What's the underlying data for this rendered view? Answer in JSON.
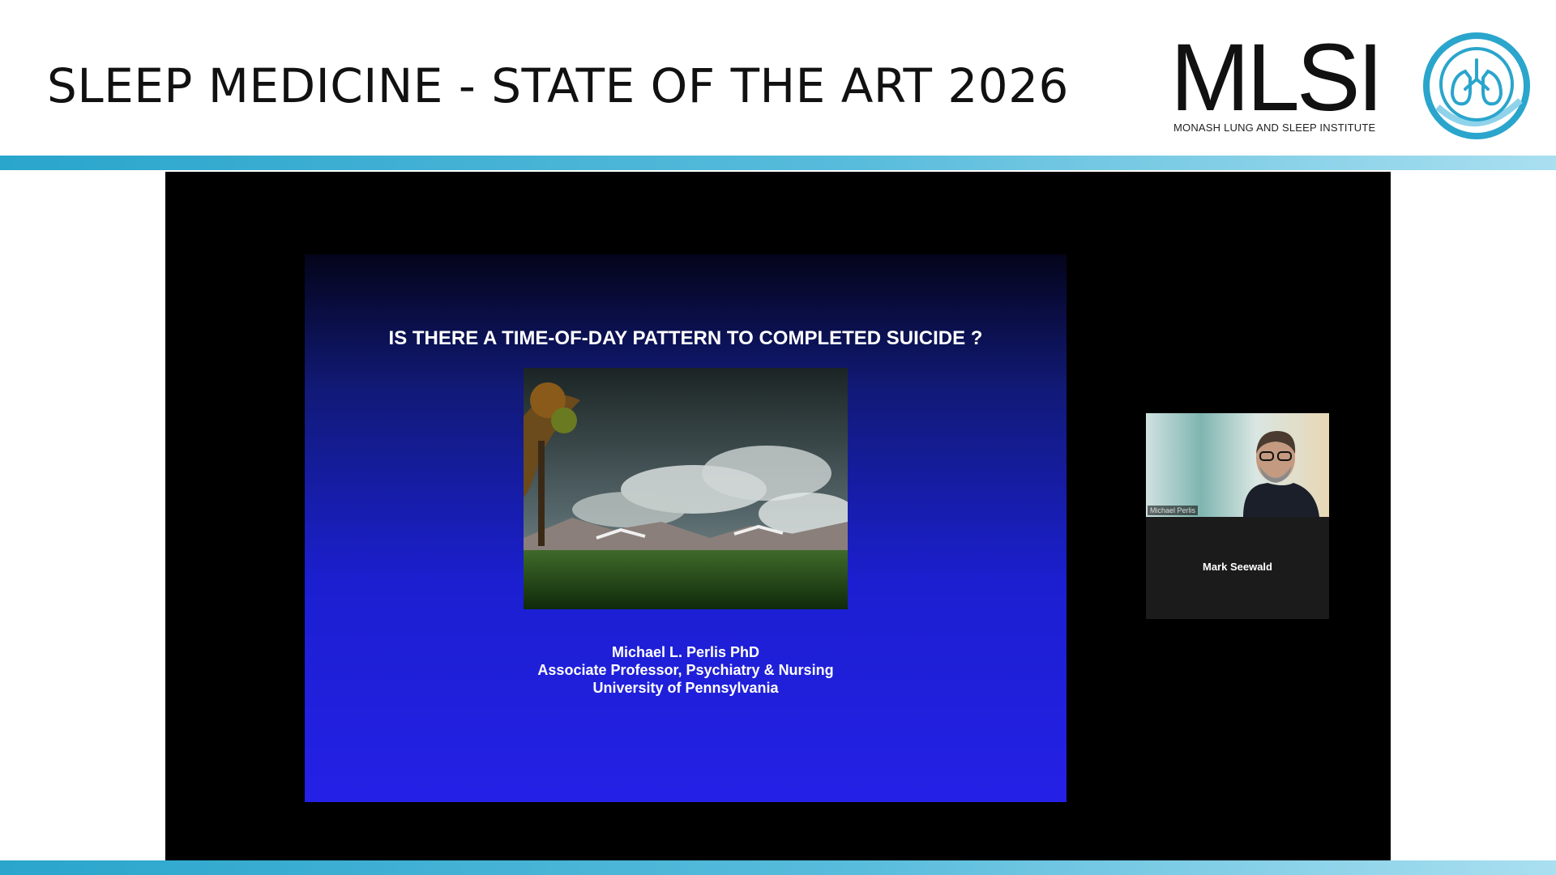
{
  "header": {
    "title": "SLEEP MEDICINE - STATE OF THE ART 2026",
    "logo_text": "MLSI",
    "logo_subtitle": "MONASH LUNG AND SLEEP INSTITUTE",
    "accent_color": "#2aa5cc"
  },
  "slide": {
    "title": "IS THERE A TIME-OF-DAY PATTERN TO COMPLETED SUICIDE ?",
    "author_name": "Michael L. Perlis PhD",
    "author_role": "Associate Professor, Psychiatry & Nursing",
    "author_affiliation": "University of Pennsylvania",
    "image_icon": "night-landscape-image"
  },
  "participant": {
    "video_label": "Michael Perlis",
    "display_name": "Mark Seewald"
  }
}
